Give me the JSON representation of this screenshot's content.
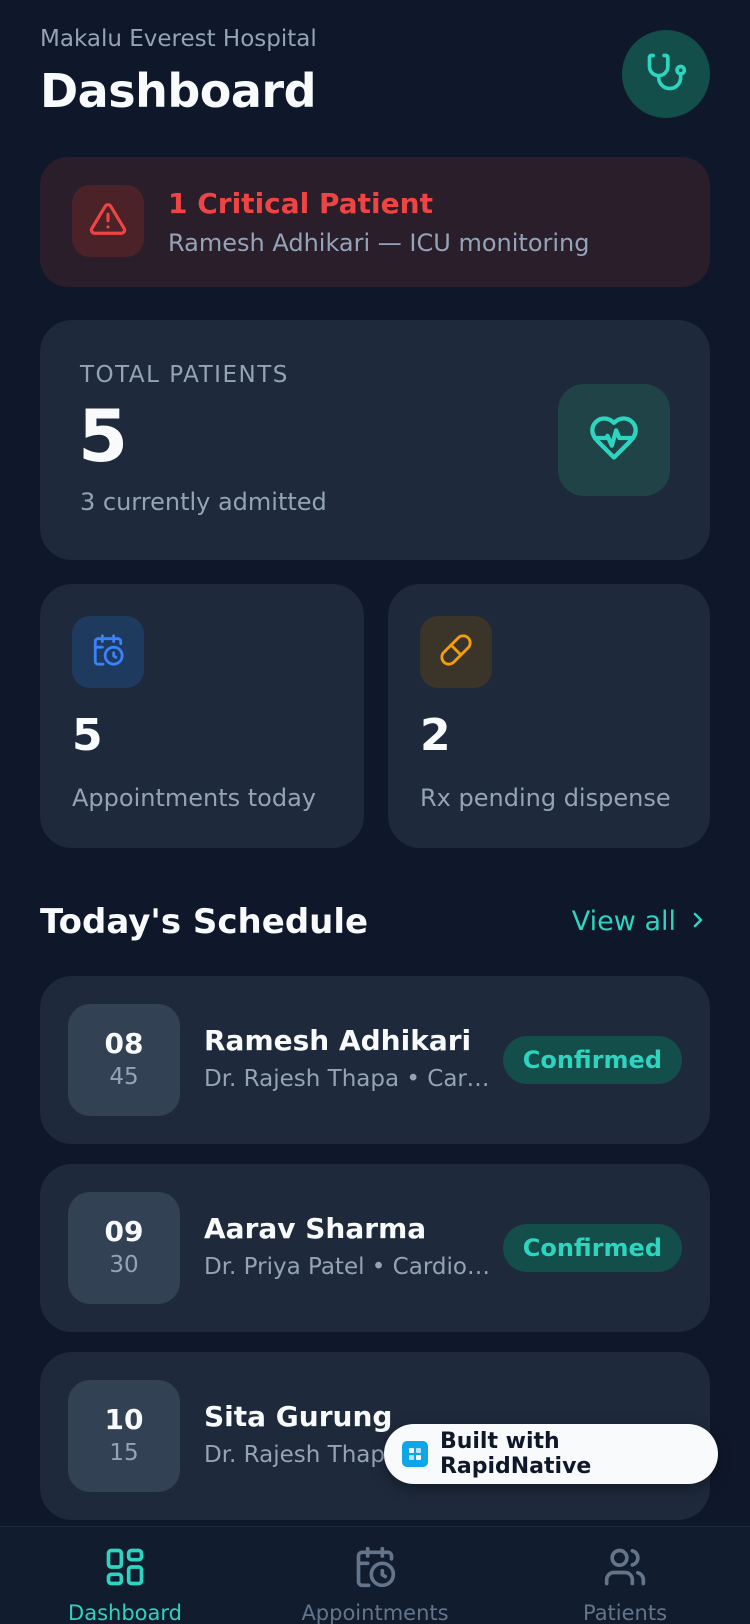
{
  "header": {
    "hospital_name": "Makalu Everest Hospital",
    "title": "Dashboard",
    "avatar_icon": "stethoscope-icon"
  },
  "alert": {
    "title": "1 Critical Patient",
    "subtitle": "Ramesh Adhikari — ICU monitoring",
    "icon": "warning-triangle-icon",
    "color": "#ef4444"
  },
  "stats": {
    "total": {
      "label": "TOTAL PATIENTS",
      "value": "5",
      "subtitle": "3 currently admitted",
      "icon": "heart-pulse-icon"
    },
    "appointments": {
      "value": "5",
      "label": "Appointments today",
      "icon": "calendar-clock-icon"
    },
    "prescriptions": {
      "value": "2",
      "label": "Rx pending dispense",
      "icon": "pill-icon"
    }
  },
  "schedule": {
    "title": "Today's Schedule",
    "view_all_label": "View all",
    "appointments": [
      {
        "hour": "08",
        "minute": "45",
        "patient": "Ramesh Adhikari",
        "details": "Dr. Rajesh Thapa • Cardiology",
        "status": "Confirmed"
      },
      {
        "hour": "09",
        "minute": "30",
        "patient": "Aarav Sharma",
        "details": "Dr. Priya Patel • Cardiology",
        "status": "Confirmed"
      },
      {
        "hour": "10",
        "minute": "15",
        "patient": "Sita Gurung",
        "details": "Dr. Rajesh Thapa",
        "status": ""
      }
    ]
  },
  "rapid_badge": {
    "label": "Built with RapidNative"
  },
  "tabs": [
    {
      "label": "Dashboard",
      "icon": "grid-icon",
      "active": true
    },
    {
      "label": "Appointments",
      "icon": "calendar-clock-icon",
      "active": false
    },
    {
      "label": "Patients",
      "icon": "users-icon",
      "active": false
    }
  ],
  "colors": {
    "background": "#0f172a",
    "card": "#1e293b",
    "accent": "#2dd4bf",
    "danger": "#ef4444",
    "warning": "#f59e0b",
    "info": "#3b82f6"
  }
}
